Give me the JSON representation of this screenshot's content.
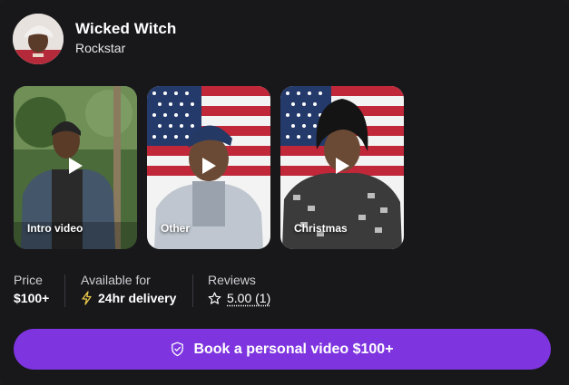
{
  "profile": {
    "name": "Wicked Witch",
    "role": "Rockstar"
  },
  "videos": [
    {
      "label": "Intro video",
      "icon": "play-icon"
    },
    {
      "label": "Other",
      "icon": "play-icon"
    },
    {
      "label": "Christmas",
      "icon": "play-icon"
    }
  ],
  "stats": {
    "price": {
      "label": "Price",
      "value": "$100+"
    },
    "availability": {
      "label": "Available for",
      "value": "24hr delivery",
      "icon": "lightning-icon"
    },
    "reviews": {
      "label": "Reviews",
      "value": "5.00 (1)",
      "icon": "star-outline-icon"
    }
  },
  "cta": {
    "label": "Book a personal video $100+",
    "icon": "shield-check-icon"
  },
  "colors": {
    "background": "#18181b",
    "accent": "#7e35e0",
    "lightning": "#e8c84a"
  }
}
